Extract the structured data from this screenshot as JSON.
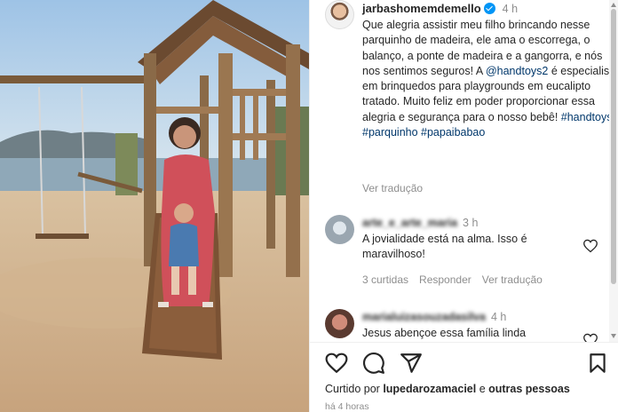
{
  "post": {
    "username": "jarbashomemdemello",
    "time": "4 h",
    "caption_start": "Que alegria assistir meu filho brincando nesse parquinho de madeira, ele ama o escorrega, o balanço, a ponte de madeira e a gangorra, e nós nos sentimos seguros! A ",
    "mention": "@handtoys2",
    "caption_end": " é especialista em brinquedos para playgrounds em eucalipto tratado. Muito feliz em poder proporcionar essa alegria e segurança para o nosso bebê! ",
    "hashtags": "#handtoys #parquinho #papaibabao",
    "translate": "Ver tradução"
  },
  "comments": [
    {
      "username": "arte_e_arte_maria",
      "time": "3 h",
      "text": "A jovialidade está na alma. Isso é maravilhoso!",
      "likes": "3 curtidas",
      "reply": "Responder",
      "translate": "Ver tradução"
    },
    {
      "username": "marialuizasouzadasilva",
      "time": "4 h",
      "text": "Jesus abençoe essa família linda"
    }
  ],
  "footer": {
    "liked_prefix": "Curtido por ",
    "liked_user": "lupedarozamaciel",
    "liked_middle": " e ",
    "liked_others": "outras pessoas",
    "ago": "há 4 horas"
  },
  "icons": [
    "heart-icon",
    "comment-icon",
    "share-icon",
    "bookmark-icon",
    "verified-icon"
  ],
  "colors": {
    "link": "#00376b",
    "verified": "#0095f6",
    "muted": "#8e8e8e"
  }
}
